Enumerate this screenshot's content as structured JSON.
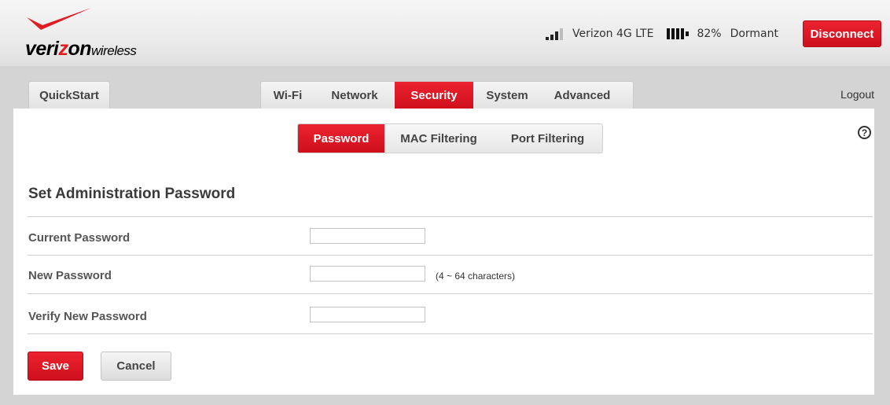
{
  "brand": {
    "logo_text_bold": "veri",
    "logo_text_bold_2": "on",
    "logo_text_light": "wireless",
    "colors": {
      "accent": "#d7141f",
      "checkmark": "#e11b22"
    }
  },
  "status": {
    "signal_icon": "signal-bars-icon",
    "signal_bars": 3,
    "signal_bars_total": 4,
    "network": "Verizon 4G LTE",
    "battery_icon": "battery-icon",
    "battery_percent": "82%",
    "connection_state": "Dormant",
    "disconnect_label": "Disconnect"
  },
  "nav": {
    "quickstart_label": "QuickStart",
    "tabs": [
      {
        "label": "Wi-Fi",
        "active": false
      },
      {
        "label": "Network",
        "active": false
      },
      {
        "label": "Security",
        "active": true
      },
      {
        "label": "System",
        "active": false
      },
      {
        "label": "Advanced",
        "active": false
      }
    ],
    "logout_label": "Logout"
  },
  "subtabs": [
    {
      "label": "Password",
      "active": true
    },
    {
      "label": "MAC Filtering",
      "active": false
    },
    {
      "label": "Port Filtering",
      "active": false
    }
  ],
  "help_icon": "question-circle-icon",
  "help_glyph": "?",
  "form": {
    "title": "Set Administration Password",
    "fields": [
      {
        "label": "Current Password",
        "value": "",
        "hint": ""
      },
      {
        "label": "New Password",
        "value": "",
        "hint": "(4 ~ 64 characters)"
      },
      {
        "label": "Verify New Password",
        "value": "",
        "hint": ""
      }
    ],
    "save_label": "Save",
    "cancel_label": "Cancel"
  }
}
